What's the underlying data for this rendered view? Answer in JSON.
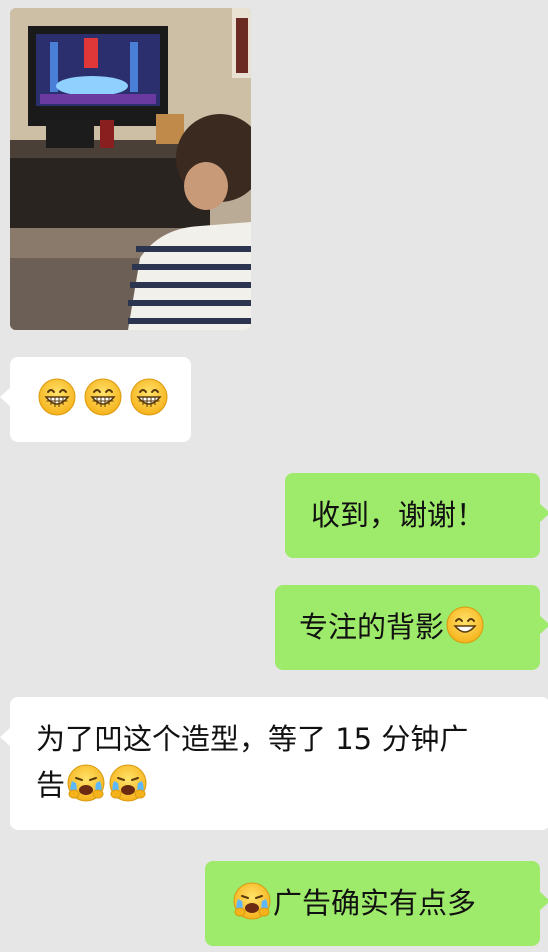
{
  "messages": {
    "photo": {
      "sender": "contact",
      "type": "image"
    },
    "m1": {
      "sender": "contact",
      "emojis": [
        "grinning-face-icon",
        "grinning-face-icon",
        "grinning-face-icon"
      ]
    },
    "m2": {
      "sender": "me",
      "text": "收到，谢谢！"
    },
    "m3": {
      "sender": "me",
      "text": "专注的背影",
      "emoji_after": "smiling-face-icon"
    },
    "m4": {
      "sender": "contact",
      "line1": "为了凹这个造型，等了 15 分钟广",
      "line2": "告",
      "emojis_after": [
        "crying-face-icon",
        "crying-face-icon"
      ]
    },
    "m5": {
      "sender": "me",
      "emoji_before": "crying-face-icon",
      "text": "广告确实有点多"
    }
  },
  "colors": {
    "background": "#e6e6e6",
    "incoming_bubble": "#ffffff",
    "outgoing_bubble": "#9eea6a"
  }
}
